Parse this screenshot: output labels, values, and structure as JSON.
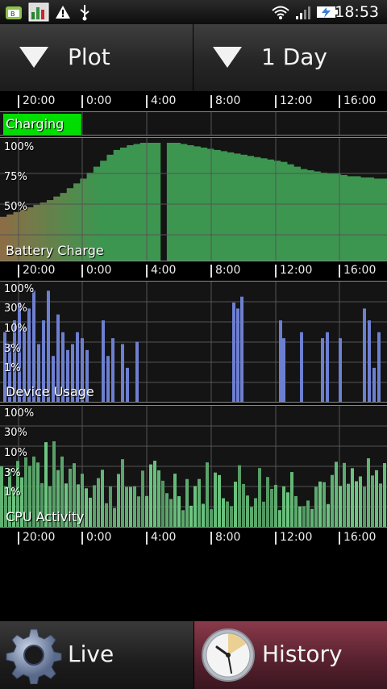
{
  "status_bar": {
    "time": "18:53",
    "icons": [
      "app-notification-icon",
      "battery-app-icon",
      "warning-icon",
      "usb-icon",
      "wifi-icon",
      "signal-icon",
      "battery-charging-icon"
    ]
  },
  "controls": {
    "plot_label": "Plot",
    "range_label": "1 Day"
  },
  "time_axis": {
    "ticks": [
      "20:00",
      "0:00",
      "4:00",
      "8:00",
      "12:00",
      "16:00"
    ]
  },
  "panels": {
    "charging": {
      "label": "Charging",
      "charging_until_fraction": 0.21,
      "color": "#00dd00"
    },
    "battery": {
      "label": "Battery Charge",
      "y_ticks": [
        "100%",
        "75%",
        "50%"
      ],
      "values": [
        38,
        40,
        42,
        44,
        46,
        48,
        50,
        52,
        55,
        58,
        62,
        66,
        70,
        75,
        80,
        85,
        90,
        94,
        96,
        98,
        99,
        100,
        100,
        100,
        0,
        100,
        100,
        99,
        98,
        97,
        96,
        95,
        94,
        93,
        92,
        91,
        90,
        89,
        88,
        87,
        86,
        85,
        84,
        82,
        80,
        78,
        77,
        76,
        75,
        74,
        74,
        73,
        72,
        72,
        71,
        71,
        70,
        70
      ],
      "color_top": "#5d9a5d"
    },
    "device_usage": {
      "label": "Device Usage",
      "y_ticks": [
        "100%",
        "30%",
        "10%",
        "3%",
        "1%"
      ],
      "values": [
        0,
        0,
        70,
        60,
        90,
        0,
        80,
        50,
        60,
        90,
        55,
        70,
        45,
        40,
        40,
        70,
        50,
        40,
        50,
        20,
        0,
        55,
        0,
        50,
        55,
        0,
        0,
        0,
        0,
        0,
        0,
        0,
        0,
        0,
        0,
        0,
        0,
        0,
        0,
        0,
        0,
        0,
        0,
        0,
        0,
        0,
        0,
        0,
        0,
        0,
        0,
        0,
        0,
        0,
        0,
        0,
        0,
        0,
        0,
        0,
        0,
        0,
        0,
        0,
        0,
        0,
        0,
        0,
        0,
        0,
        0,
        0,
        0,
        0,
        0,
        0,
        0,
        0,
        0,
        0,
        0,
        0,
        0,
        0,
        0,
        0,
        0,
        0,
        0,
        0,
        0,
        0,
        0,
        0,
        0,
        0,
        0,
        0,
        0,
        0,
        0,
        0,
        0,
        0,
        0,
        0,
        0,
        0,
        0,
        0,
        0,
        0,
        0,
        0,
        0,
        0,
        0,
        0,
        0,
        0,
        0,
        0,
        0,
        0,
        0,
        0,
        0,
        0,
        0,
        0,
        0,
        0,
        0,
        0,
        0,
        0,
        0,
        0,
        0,
        0,
        0,
        0,
        0,
        0,
        0,
        0,
        0,
        0,
        0,
        0,
        0,
        0,
        0,
        0,
        0,
        0,
        0,
        0,
        0,
        0,
        0,
        0,
        0,
        0,
        0,
        0,
        0,
        0,
        0,
        0,
        0,
        0,
        0,
        0,
        0,
        0,
        0,
        0,
        0,
        0,
        0,
        0,
        0,
        0,
        0,
        0,
        0,
        0,
        0,
        0,
        0,
        0,
        0,
        0,
        0,
        0,
        0,
        0,
        0,
        0,
        0,
        0,
        0,
        0,
        0,
        0,
        0,
        0,
        0,
        0,
        0,
        0,
        0,
        0,
        0,
        0,
        0,
        0,
        0,
        0,
        0,
        0,
        0,
        0,
        0,
        0,
        0,
        0,
        0,
        0,
        0,
        0,
        0,
        0,
        0,
        0,
        0,
        0,
        0,
        0,
        0,
        0,
        0,
        0,
        0,
        0,
        0,
        0,
        0,
        0,
        0,
        0,
        0,
        0,
        0,
        0,
        0,
        0,
        0,
        0,
        0,
        0,
        0,
        0,
        0,
        0,
        0,
        0,
        0,
        0,
        0,
        0,
        0,
        0,
        0,
        0,
        0,
        0,
        0,
        0,
        0,
        0,
        0,
        0,
        0,
        0,
        0,
        0,
        0,
        0,
        0,
        0,
        0,
        0,
        0,
        0,
        0,
        0,
        0,
        0
      ],
      "color": "#6d7fd0"
    },
    "cpu": {
      "label": "CPU Activity",
      "y_ticks": [
        "100%",
        "30%",
        "10%",
        "3%",
        "1%"
      ],
      "color": "#7fc98a"
    }
  },
  "bottom": {
    "live_label": "Live",
    "history_label": "History"
  }
}
